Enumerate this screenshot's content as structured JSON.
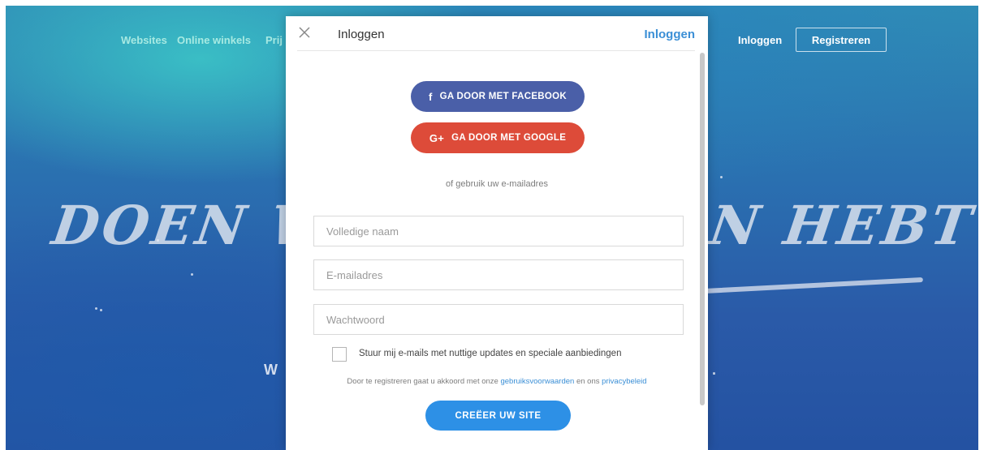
{
  "background": {
    "nav": {
      "links": [
        "Websites",
        "Online winkels",
        "Prij"
      ],
      "login": "Inloggen",
      "register": "Registreren"
    },
    "headline_left": "DOEN WA",
    "headline_right": "N HEBT",
    "sub_left": "W",
    "sub_right": "."
  },
  "modal": {
    "title": "Inloggen",
    "header_link": "Inloggen",
    "facebook": {
      "glyph": "f",
      "label": "GA DOOR MET FACEBOOK",
      "color": "#4a5fa8"
    },
    "google": {
      "glyph": "G+",
      "label": "GA DOOR MET GOOGLE",
      "color": "#dd4b39"
    },
    "or_text": "of gebruik uw e-mailadres",
    "fields": {
      "name_placeholder": "Volledige naam",
      "email_placeholder": "E-mailadres",
      "password_placeholder": "Wachtwoord"
    },
    "newsletter_label": "Stuur mij e-mails met nuttige updates en speciale aanbiedingen",
    "terms": {
      "prefix": "Door te registreren gaat u akkoord met onze",
      "terms_link": "gebruiksvoorwaarden",
      "middle": "en ons",
      "privacy_link": "privacybeleid"
    },
    "create_button": "CREËER UW SITE",
    "accent_color": "#2d90e6"
  }
}
